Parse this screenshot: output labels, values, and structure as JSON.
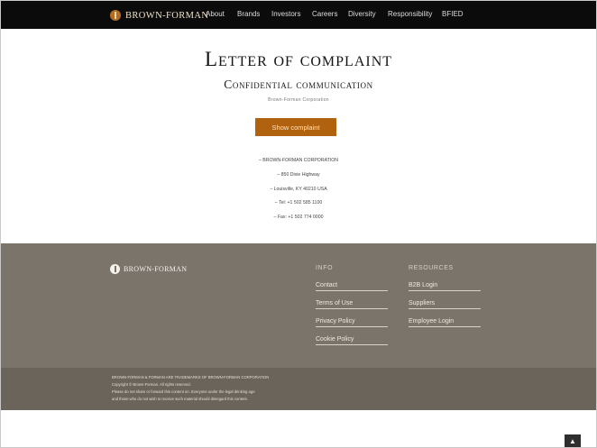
{
  "nav": {
    "logo_text": "BROWN-FORMAN",
    "links": [
      "About",
      "Brands",
      "Investors",
      "Careers",
      "Diversity",
      "Responsibility",
      "BFIED"
    ]
  },
  "main": {
    "title": "Letter of complaint",
    "subtitle": "Confidential communication",
    "company_line": "Brown-Forman Corporation",
    "show_button": "Show complaint",
    "address": [
      "– BROWN-FORMAN CORPORATION",
      "– 850 Dixie Highway",
      "– Louisville, KY 40210 USA",
      "– Tel: +1 502 585 1100",
      "– Fax: +1 502 774 0000"
    ]
  },
  "footer": {
    "logo_text": "BROWN-FORMAN",
    "info_heading": "INFO",
    "info_links": [
      "Contact",
      "Terms of Use",
      "Privacy Policy",
      "Cookie Policy"
    ],
    "resources_heading": "RESOURCES",
    "resources_links": [
      "B2B Login",
      "Suppliers",
      "Employee Login"
    ],
    "legal_lines": [
      "BROWN-FORMAN & FORMAN ARE TRADEMARKS OF BROWN-FORMAN CORPORATION",
      "Copyright © Brown-Forman. All rights reserved.",
      "Please do not share or forward this content on. Everyone under the legal drinking age",
      "and those who do not wish to receive such material should disregard this content."
    ],
    "to_top": "▲"
  },
  "colors": {
    "nav_bg": "#0b0b0b",
    "accent": "#b0620f",
    "footer_bg": "#7b746b",
    "legal_bg": "#6a645b"
  }
}
